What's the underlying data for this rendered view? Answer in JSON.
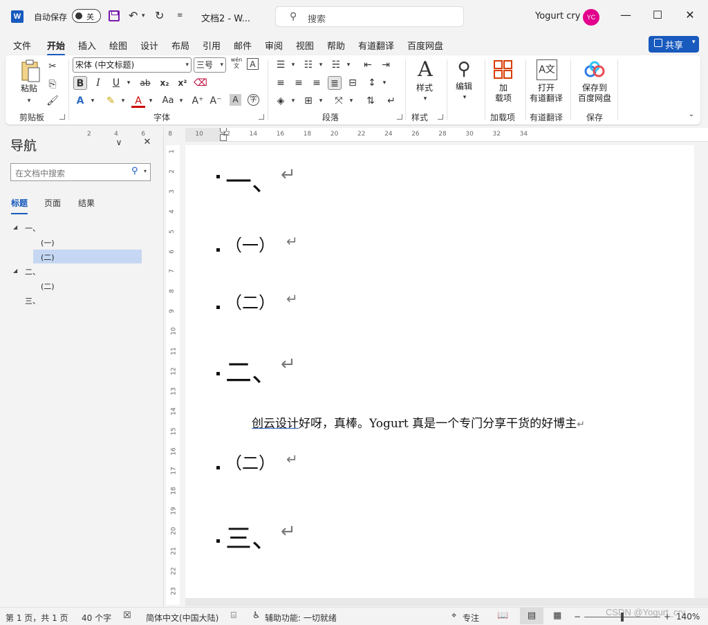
{
  "titlebar": {
    "app_icon": "W",
    "autosave_label": "自动保存",
    "autosave_state": "关",
    "doc_title": "文档2  -  W...",
    "search_placeholder": "搜索",
    "user_name": "Yogurt cry",
    "avatar_initials": "YC",
    "icons": [
      "word-app-icon",
      "save-icon",
      "undo-icon",
      "redo-icon",
      "customize-icon",
      "search-icon",
      "minimize-icon",
      "maximize-icon",
      "close-icon"
    ]
  },
  "menu": {
    "tabs": [
      "文件",
      "开始",
      "插入",
      "绘图",
      "设计",
      "布局",
      "引用",
      "邮件",
      "审阅",
      "视图",
      "帮助",
      "有道翻译",
      "百度网盘"
    ],
    "active": "开始",
    "share_label": "共享"
  },
  "ribbon": {
    "clipboard": {
      "paste": "粘贴",
      "label": "剪贴板"
    },
    "font": {
      "font_name": "宋体 (中文标题)",
      "font_size": "三号",
      "pinyin_glyph": "wén",
      "pinyin_sub": "文",
      "border_glyph": "A",
      "label": "字体",
      "buttons": [
        "B",
        "I",
        "U",
        "ab",
        "x₂",
        "x²"
      ],
      "row3": [
        "A",
        "A",
        "Aa",
        "A",
        "字"
      ]
    },
    "paragraph": {
      "label": "段落"
    },
    "styles": {
      "button": "样式",
      "label": "样式"
    },
    "editing": {
      "button": "编辑"
    },
    "addins": {
      "button_line1": "加",
      "button_line2": "载项",
      "label": "加载项"
    },
    "youdao": {
      "button_line1": "打开",
      "button_line2": "有道翻译",
      "label": "有道翻译"
    },
    "baidu": {
      "button_line1": "保存到",
      "button_line2": "百度网盘",
      "label": "保存"
    }
  },
  "nav": {
    "title": "导航",
    "search_placeholder": "在文档中搜索",
    "tabs": [
      "标题",
      "页面",
      "结果"
    ],
    "active_tab": "标题",
    "tree": [
      {
        "text": "一、",
        "level": 1,
        "expanded": true
      },
      {
        "text": "(一)",
        "level": 2
      },
      {
        "text": "(二)",
        "level": 2,
        "selected": true
      },
      {
        "text": "二、",
        "level": 1,
        "expanded": true
      },
      {
        "text": "(二)",
        "level": 2
      },
      {
        "text": "三、",
        "level": 1
      }
    ]
  },
  "ruler": {
    "h": [
      "2",
      "4",
      "6",
      "8",
      "10",
      "12",
      "14",
      "16",
      "18",
      "20",
      "22",
      "24",
      "26",
      "28",
      "30",
      "32",
      "34"
    ],
    "v": [
      "1",
      "2",
      "3",
      "4",
      "5",
      "6",
      "7",
      "8",
      "9",
      "10",
      "11",
      "12",
      "13",
      "14",
      "15",
      "16",
      "17",
      "18",
      "19",
      "20",
      "21",
      "22",
      "23"
    ]
  },
  "document": {
    "headings": [
      {
        "text": "一、",
        "level": 1
      },
      {
        "text": "（一）",
        "level": 2
      },
      {
        "text": "（二）",
        "level": 2
      },
      {
        "text": "二、",
        "level": 1
      },
      {
        "text": "（二）",
        "level": 2
      },
      {
        "text": "三、",
        "level": 1
      }
    ],
    "paragraph_link": "创云设计",
    "paragraph_rest": "好呀，真棒。Yogurt 真是一个专门分享干货的好博主",
    "para_mark": "↵"
  },
  "status": {
    "page": "第 1 页，共 1 页",
    "words": "40 个字",
    "language": "简体中文(中国大陆)",
    "accessibility": "辅助功能: 一切就绪",
    "focus": "专注",
    "zoom": "140%",
    "watermark": "CSDN @Yogurt_cry"
  }
}
